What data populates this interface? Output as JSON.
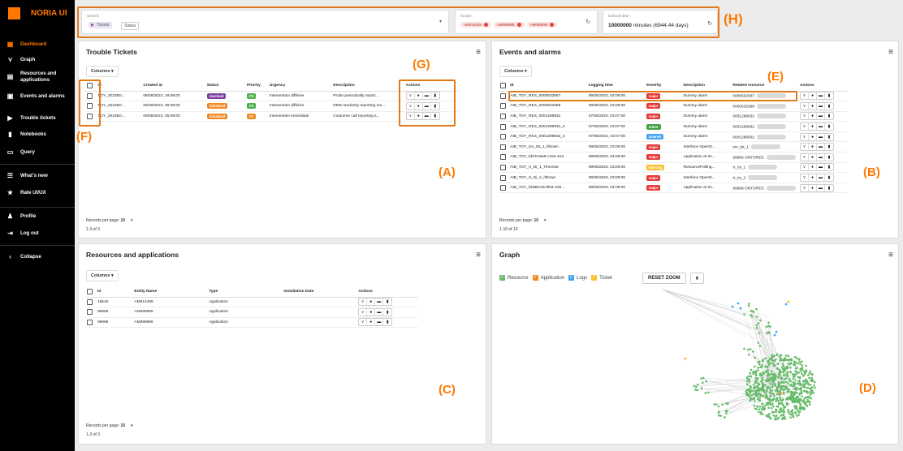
{
  "app": {
    "name": "NORIA UI"
  },
  "sidebar": {
    "items": [
      {
        "label": "Dashboard",
        "icon": "dashboard-icon",
        "active": true
      },
      {
        "label": "Graph",
        "icon": "graph-icon"
      },
      {
        "label": "Resources and applications",
        "icon": "resources-icon"
      },
      {
        "label": "Events and alarms",
        "icon": "alarms-icon"
      },
      {
        "label": "Trouble tickets",
        "icon": "ticket-icon"
      },
      {
        "label": "Notebooks",
        "icon": "notebook-icon"
      },
      {
        "label": "Query",
        "icon": "query-icon"
      },
      {
        "label": "What's new",
        "icon": "news-icon"
      },
      {
        "label": "Rate UI/UX",
        "icon": "star-icon"
      },
      {
        "label": "Profile",
        "icon": "profile-icon"
      },
      {
        "label": "Log out",
        "icon": "logout-icon"
      },
      {
        "label": "Collapse",
        "icon": "collapse-icon"
      }
    ]
  },
  "search": {
    "label": "Search",
    "tag": "Tickets",
    "status": "Status"
  },
  "scope": {
    "label": "Scope :",
    "chips": [
      "AM014459",
      "AM099995",
      "AM099996"
    ]
  },
  "default_time": {
    "label": "Default time :",
    "value": "10000000",
    "unit": "minutes (6944.44 days)"
  },
  "annotations": [
    "(H)",
    "(G)",
    "(E)",
    "(F)",
    "(A)",
    "(B)",
    "(C)",
    "(D)"
  ],
  "common": {
    "columns": "Columns",
    "records_per_page": "Records per page:",
    "rpp_value": "10",
    "actions": "Actions"
  },
  "trouble_tickets": {
    "title": "Trouble Tickets",
    "range": "1-3 of 3",
    "headers": [
      "Id",
      "Created at",
      "Status",
      "Priority",
      "Urgency",
      "Description",
      "Actions"
    ],
    "rows": [
      {
        "id": "TOY_20235D...",
        "created": "08/08/2023, 16:08:00",
        "status": "resolved",
        "status_color": "#7b3fa0",
        "priority": "P3",
        "priority_color": "#4caf50",
        "urgency": "Intervention différée",
        "desc": "Probe periodically report..."
      },
      {
        "id": "TOY_20235D...",
        "created": "09/08/2023, 05:09:00",
        "status": "initialized",
        "status_color": "#f08a24",
        "priority": "P3",
        "priority_color": "#4caf50",
        "urgency": "Intervention différée",
        "desc": "NMS randomly reporting mo..."
      },
      {
        "id": "TOY_20235D...",
        "created": "09/08/2023, 05:09:00",
        "status": "initialized",
        "status_color": "#f08a24",
        "priority": "P2",
        "priority_color": "#f08a24",
        "urgency": "Intervention immédiate",
        "desc": "Customer call reporting s..."
      }
    ]
  },
  "events": {
    "title": "Events and alarms",
    "range": "1-10 of 10",
    "headers": [
      "Id",
      "Logging time",
      "Severity",
      "Description",
      "Related resource",
      "Actions"
    ],
    "rows": [
      {
        "id": "AIB_TOY_RES_0000532587",
        "time": "09/05/2023, 02:09:00",
        "sev": "major",
        "sev_color": "#e53935",
        "desc": "Dummy alarm",
        "res": "0000532587"
      },
      {
        "id": "AIB_TOY_RES_0000532588",
        "time": "09/08/2023, 03:09:00",
        "sev": "major",
        "sev_color": "#e53935",
        "desc": "Dummy alarm",
        "res": "0000532588"
      },
      {
        "id": "AIB_TOY_RES_0001288932",
        "time": "07/08/2023, 03:07:00",
        "sev": "major",
        "sev_color": "#e53935",
        "desc": "Dummy alarm",
        "res": "0001288932"
      },
      {
        "id": "AIB_TOY_RES_0001288932_2",
        "time": "07/08/2023, 03:07:00",
        "sev": "minor",
        "sev_color": "#43a047",
        "desc": "Dummy alarm",
        "res": "0001288932"
      },
      {
        "id": "AIB_TOY_RES_0001288932_3",
        "time": "07/08/2023, 03:07:00",
        "sev": "cleared",
        "sev_color": "#42a5f5",
        "desc": "Dummy alarm",
        "res": "0001288932"
      },
      {
        "id": "AIB_TOY_srv_tst_1_ifDown",
        "time": "09/08/2023, 03:09:00",
        "sev": "major",
        "sev_color": "#e53935",
        "desc": "Interface OperSt...",
        "res": "srv_tst_1"
      },
      {
        "id": "AIB_TOY_bb7018a9-c15e-4e3...",
        "time": "09/08/2023, 04:09:00",
        "sev": "major",
        "sev_color": "#e53935",
        "desc": "Application at ris...",
        "res": "99995 ONTORES"
      },
      {
        "id": "AIB_TOY_rt_tsi_1_TimeOut",
        "time": "09/08/2023, 03:09:00",
        "sev": "warning",
        "sev_color": "#fbc02d",
        "desc": "ResourcePolling...",
        "res": "rt_tsi_1"
      },
      {
        "id": "AIB_TOY_rt_tsi_2_ifDown",
        "time": "09/08/2023, 03:09:00",
        "sev": "major",
        "sev_color": "#e53935",
        "desc": "Interface OperSt...",
        "res": "rt_tsi_2"
      },
      {
        "id": "AIB_TOY_fd38bc26-8f34-445...",
        "time": "09/08/2023, 04:09:00",
        "sev": "major",
        "sev_color": "#e53935",
        "desc": "Application at ris...",
        "res": "99996 ONTORES"
      }
    ]
  },
  "resources": {
    "title": "Resources and applications",
    "range": "1-3 of 3",
    "headers": [
      "Id",
      "Entity Name",
      "Type",
      "Installation Date",
      "Actions"
    ],
    "rows": [
      {
        "id": "16540",
        "name": "AM014459",
        "type": "Application",
        "date": ""
      },
      {
        "id": "99995",
        "name": "AM099995",
        "type": "Application",
        "date": ""
      },
      {
        "id": "99996",
        "name": "AM099996",
        "type": "Application",
        "date": ""
      }
    ]
  },
  "graph": {
    "title": "Graph",
    "legend": [
      {
        "label": "Resource",
        "color": "#66bb6a"
      },
      {
        "label": "Application",
        "color": "#ef8a1f"
      },
      {
        "label": "Logs",
        "color": "#42a5f5"
      },
      {
        "label": "Ticket",
        "color": "#fbc02d"
      }
    ],
    "reset_zoom": "RESET ZOOM"
  }
}
